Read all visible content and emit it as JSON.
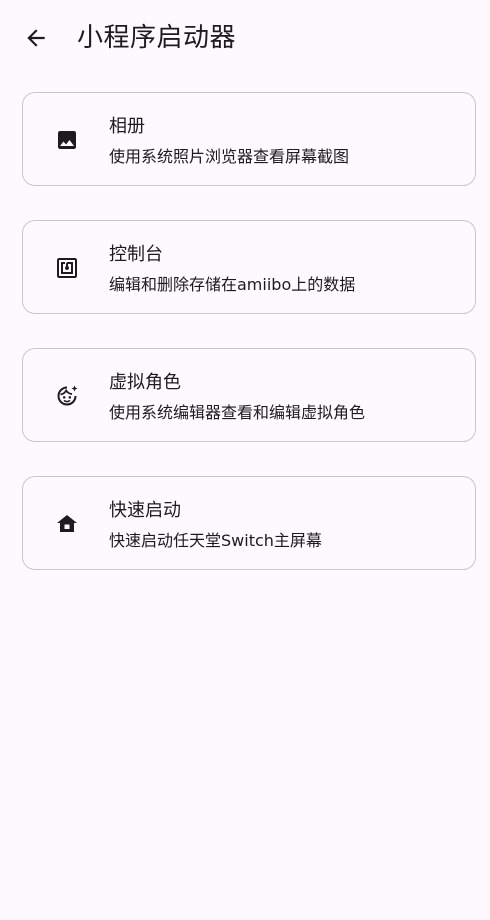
{
  "header": {
    "back_icon": "arrow-back-icon",
    "title": "小程序启动器"
  },
  "cards": [
    {
      "icon": "image-icon",
      "title": "相册",
      "description": "使用系统照片浏览器查看屏幕截图"
    },
    {
      "icon": "nfc-icon",
      "title": "控制台",
      "description": "编辑和删除存储在amiibo上的数据"
    },
    {
      "icon": "face-sparkle-icon",
      "title": "虚拟角色",
      "description": "使用系统编辑器查看和编辑虚拟角色"
    },
    {
      "icon": "home-icon",
      "title": "快速启动",
      "description": "快速启动任天堂Switch主屏幕"
    }
  ],
  "colors": {
    "background": "#fdf9fc",
    "text": "#1c1b1f",
    "card_border": "#cbc6cc"
  }
}
